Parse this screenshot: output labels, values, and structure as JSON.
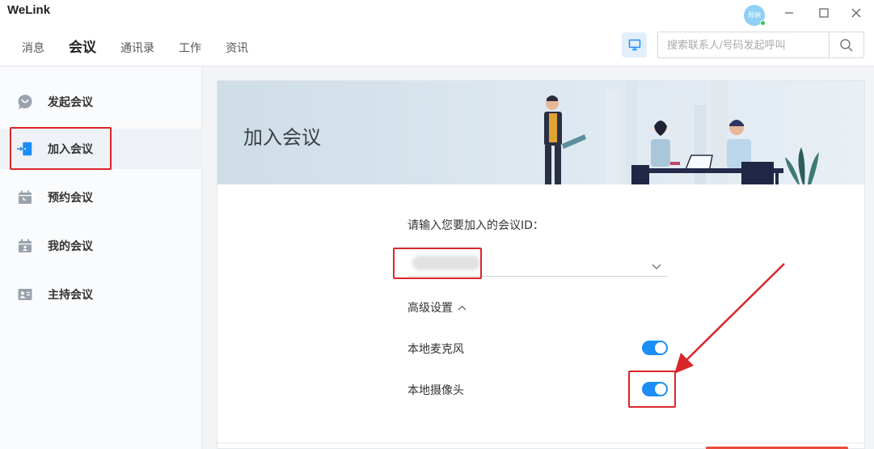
{
  "app": {
    "title": "WeLink"
  },
  "nav": {
    "tabs": [
      "消息",
      "会议",
      "通讯录",
      "工作",
      "资讯"
    ],
    "active": "会议"
  },
  "user": {
    "avatar_text": "局纳",
    "status_color": "#35c759"
  },
  "search": {
    "placeholder": "搜索联系人/号码发起呼叫"
  },
  "sidebar": {
    "items": [
      {
        "label": "发起会议",
        "icon": "start-meeting-icon"
      },
      {
        "label": "加入会议",
        "icon": "join-meeting-icon"
      },
      {
        "label": "预约会议",
        "icon": "calendar-icon"
      },
      {
        "label": "我的会议",
        "icon": "my-meeting-icon"
      },
      {
        "label": "主持会议",
        "icon": "host-meeting-icon"
      }
    ],
    "active": "加入会议"
  },
  "main": {
    "banner_title": "加入会议",
    "meeting_id_label": "请输入您要加入的会议ID：",
    "meeting_id_value": "",
    "advanced_label": "高级设置",
    "options": [
      {
        "label": "本地麦克风",
        "enabled": true
      },
      {
        "label": "本地摄像头",
        "enabled": true
      }
    ]
  },
  "colors": {
    "accent": "#1c8ef5",
    "highlight": "#d9262a",
    "toggle_on": "#1c8ef5"
  }
}
